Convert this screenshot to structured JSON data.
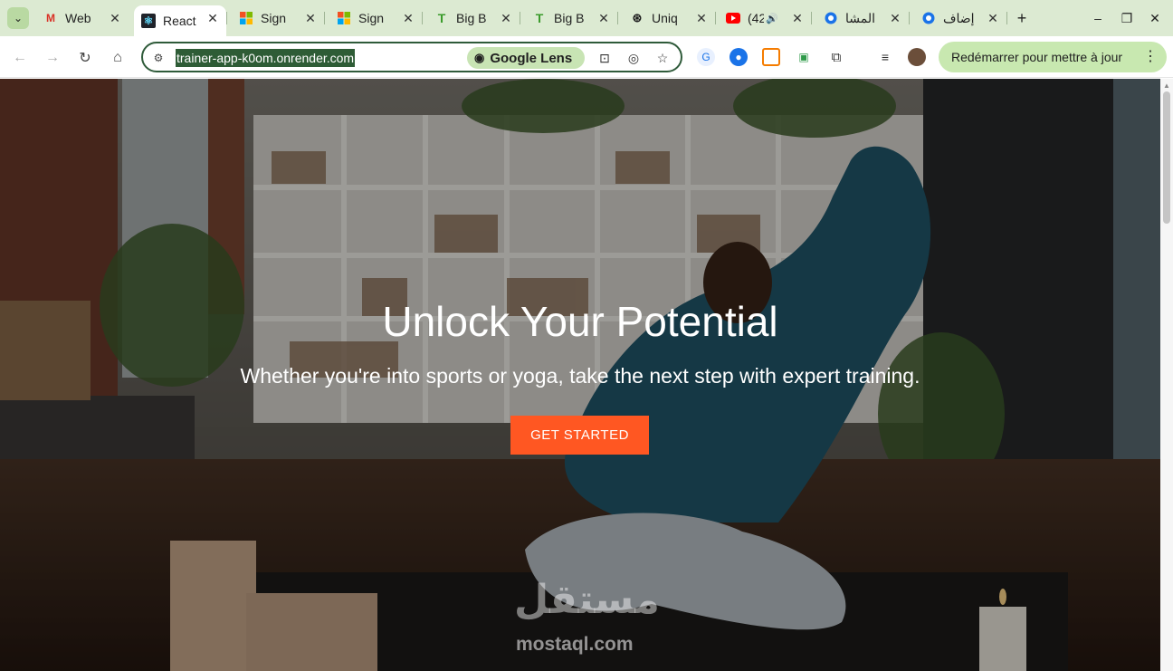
{
  "tabs": [
    {
      "title": "Web",
      "favicon": "gmail-icon",
      "active": false
    },
    {
      "title": "React",
      "favicon": "react-icon",
      "active": true
    },
    {
      "title": "Sign",
      "favicon": "microsoft-icon",
      "active": false
    },
    {
      "title": "Sign",
      "favicon": "microsoft-icon",
      "active": false
    },
    {
      "title": "Big B",
      "favicon": "t-icon",
      "active": false
    },
    {
      "title": "Big B",
      "favicon": "t-icon",
      "active": false
    },
    {
      "title": "Uniq",
      "favicon": "openai-icon",
      "active": false
    },
    {
      "title": "(42",
      "favicon": "youtube-icon",
      "active": false
    },
    {
      "title": "المشا",
      "favicon": "circle-icon",
      "active": false
    },
    {
      "title": "إضاف",
      "favicon": "circle-icon",
      "active": false
    }
  ],
  "address_bar": {
    "url": "trainer-app-k0om.onrender.com",
    "lens_label": "Google Lens"
  },
  "update_button": {
    "label": "Redémarrer pour mettre à jour"
  },
  "hero": {
    "title": "Unlock Your Potential",
    "subtitle": "Whether you're into sports or yoga, take the next step with expert training.",
    "cta_label": "GET STARTED"
  },
  "watermark": {
    "arabic": "مستقل",
    "latin": "mostaql.com"
  },
  "colors": {
    "accent": "#ff5722",
    "tabbar": "#dcead2",
    "omnibox_border": "#2f5b3a"
  }
}
